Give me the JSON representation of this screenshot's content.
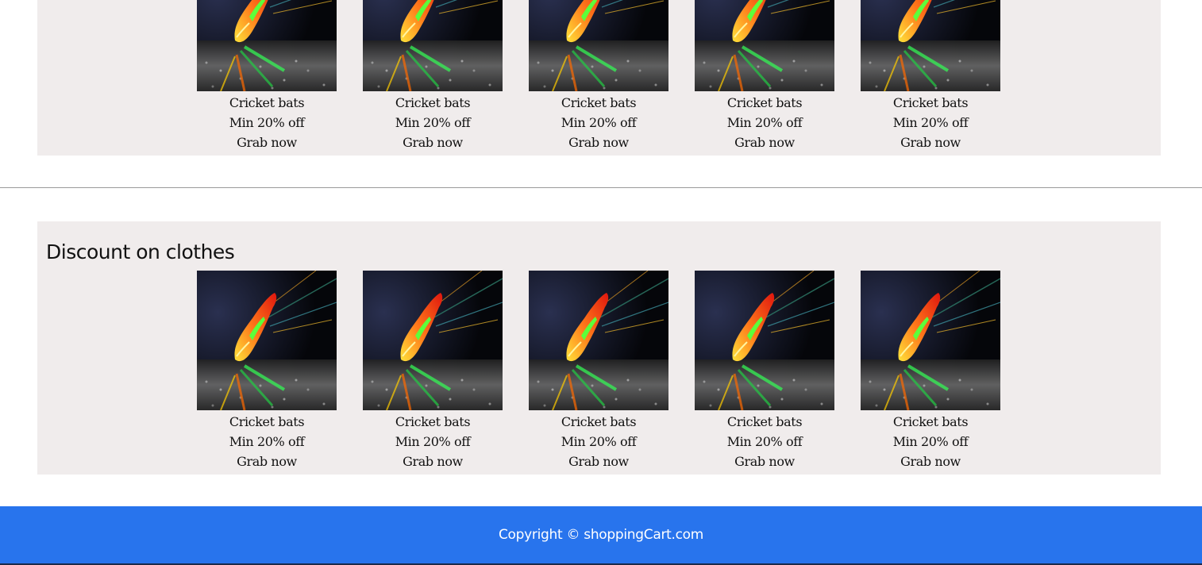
{
  "sections": [
    {
      "title": "",
      "cards": [
        {
          "image": "sports-shoe-image",
          "name": "Cricket bats",
          "offer": "Min 20% off",
          "cta": "Grab now"
        },
        {
          "image": "sports-shoe-image",
          "name": "Cricket bats",
          "offer": "Min 20% off",
          "cta": "Grab now"
        },
        {
          "image": "sports-shoe-image",
          "name": "Cricket bats",
          "offer": "Min 20% off",
          "cta": "Grab now"
        },
        {
          "image": "sports-shoe-image",
          "name": "Cricket bats",
          "offer": "Min 20% off",
          "cta": "Grab now"
        },
        {
          "image": "sports-shoe-image",
          "name": "Cricket bats",
          "offer": "Min 20% off",
          "cta": "Grab now"
        }
      ]
    },
    {
      "title": "Discount on clothes",
      "cards": [
        {
          "image": "sports-shoe-image",
          "name": "Cricket bats",
          "offer": "Min 20% off",
          "cta": "Grab now"
        },
        {
          "image": "sports-shoe-image",
          "name": "Cricket bats",
          "offer": "Min 20% off",
          "cta": "Grab now"
        },
        {
          "image": "sports-shoe-image",
          "name": "Cricket bats",
          "offer": "Min 20% off",
          "cta": "Grab now"
        },
        {
          "image": "sports-shoe-image",
          "name": "Cricket bats",
          "offer": "Min 20% off",
          "cta": "Grab now"
        },
        {
          "image": "sports-shoe-image",
          "name": "Cricket bats",
          "offer": "Min 20% off",
          "cta": "Grab now"
        }
      ]
    }
  ],
  "footer": {
    "copyright": "Copyright © shoppingCart.com"
  },
  "colors": {
    "section_background": "#f0ecec",
    "footer_background": "#2874ed",
    "footer_text": "#ffffff"
  }
}
